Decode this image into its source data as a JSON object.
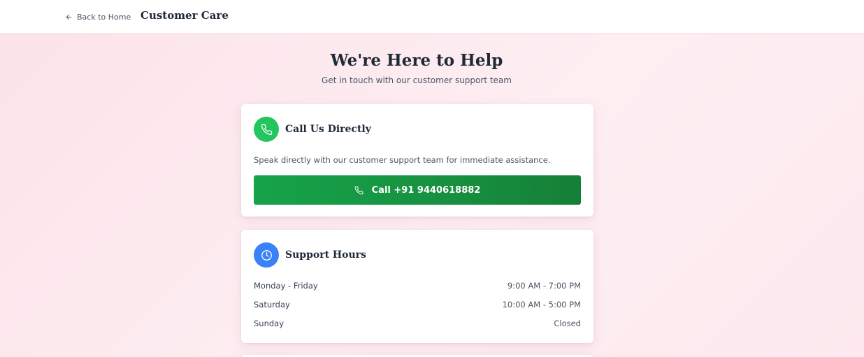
{
  "header": {
    "back_label": "Back to Home",
    "title": "Customer Care"
  },
  "hero": {
    "title": "We're Here to Help",
    "subtitle": "Get in touch with our customer support team"
  },
  "call_card": {
    "icon": "phone-icon",
    "title": "Call Us Directly",
    "description": "Speak directly with our customer support team for immediate assistance.",
    "button_label": "Call +91 9440618882"
  },
  "hours_card": {
    "icon": "clock-icon",
    "title": "Support Hours",
    "rows": [
      {
        "day": "Monday - Friday",
        "time": "9:00 AM - 7:00 PM"
      },
      {
        "day": "Saturday",
        "time": "10:00 AM - 5:00 PM"
      },
      {
        "day": "Sunday",
        "time": "Closed"
      }
    ]
  },
  "colors": {
    "call_accent": "#22c55e",
    "call_button": "#16a34a",
    "hours_accent": "#3b82f6",
    "page_background": "#fbe3e9"
  }
}
